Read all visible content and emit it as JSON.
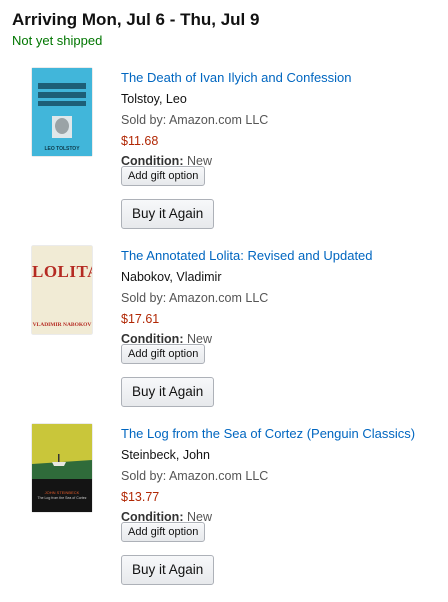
{
  "shipment": {
    "heading": "Arriving Mon, Jul 6 - Thu, Jul 9",
    "status": "Not yet shipped",
    "status_color": "#007600"
  },
  "items": [
    {
      "title": "The Death of Ivan Ilyich and Confession",
      "author": "Tolstoy, Leo",
      "seller": "Sold by: Amazon.com LLC",
      "price": "$11.68",
      "condition_label": "Condition:",
      "condition_value": "New",
      "gift_button": "Add gift option",
      "buy_button": "Buy it Again",
      "cover_text": "LEO TOLSTOY"
    },
    {
      "title": "The Annotated Lolita: Revised and Updated",
      "author": "Nabokov, Vladimir",
      "seller": "Sold by: Amazon.com LLC",
      "price": "$17.61",
      "condition_label": "Condition:",
      "condition_value": "New",
      "gift_button": "Add gift option",
      "buy_button": "Buy it Again",
      "cover_text": "LOLITA",
      "cover_subtext": "VLADIMIR NABOKOV"
    },
    {
      "title": "The Log from the Sea of Cortez (Penguin Classics)",
      "author": "Steinbeck, John",
      "seller": "Sold by: Amazon.com LLC",
      "price": "$13.77",
      "condition_label": "Condition:",
      "condition_value": "New",
      "gift_button": "Add gift option",
      "buy_button": "Buy it Again",
      "cover_text": "JOHN STEINBECK",
      "cover_subtext": "The Log from the Sea of Cortez"
    }
  ],
  "colors": {
    "link": "#0066c0",
    "price": "#B12704",
    "status": "#007600"
  }
}
